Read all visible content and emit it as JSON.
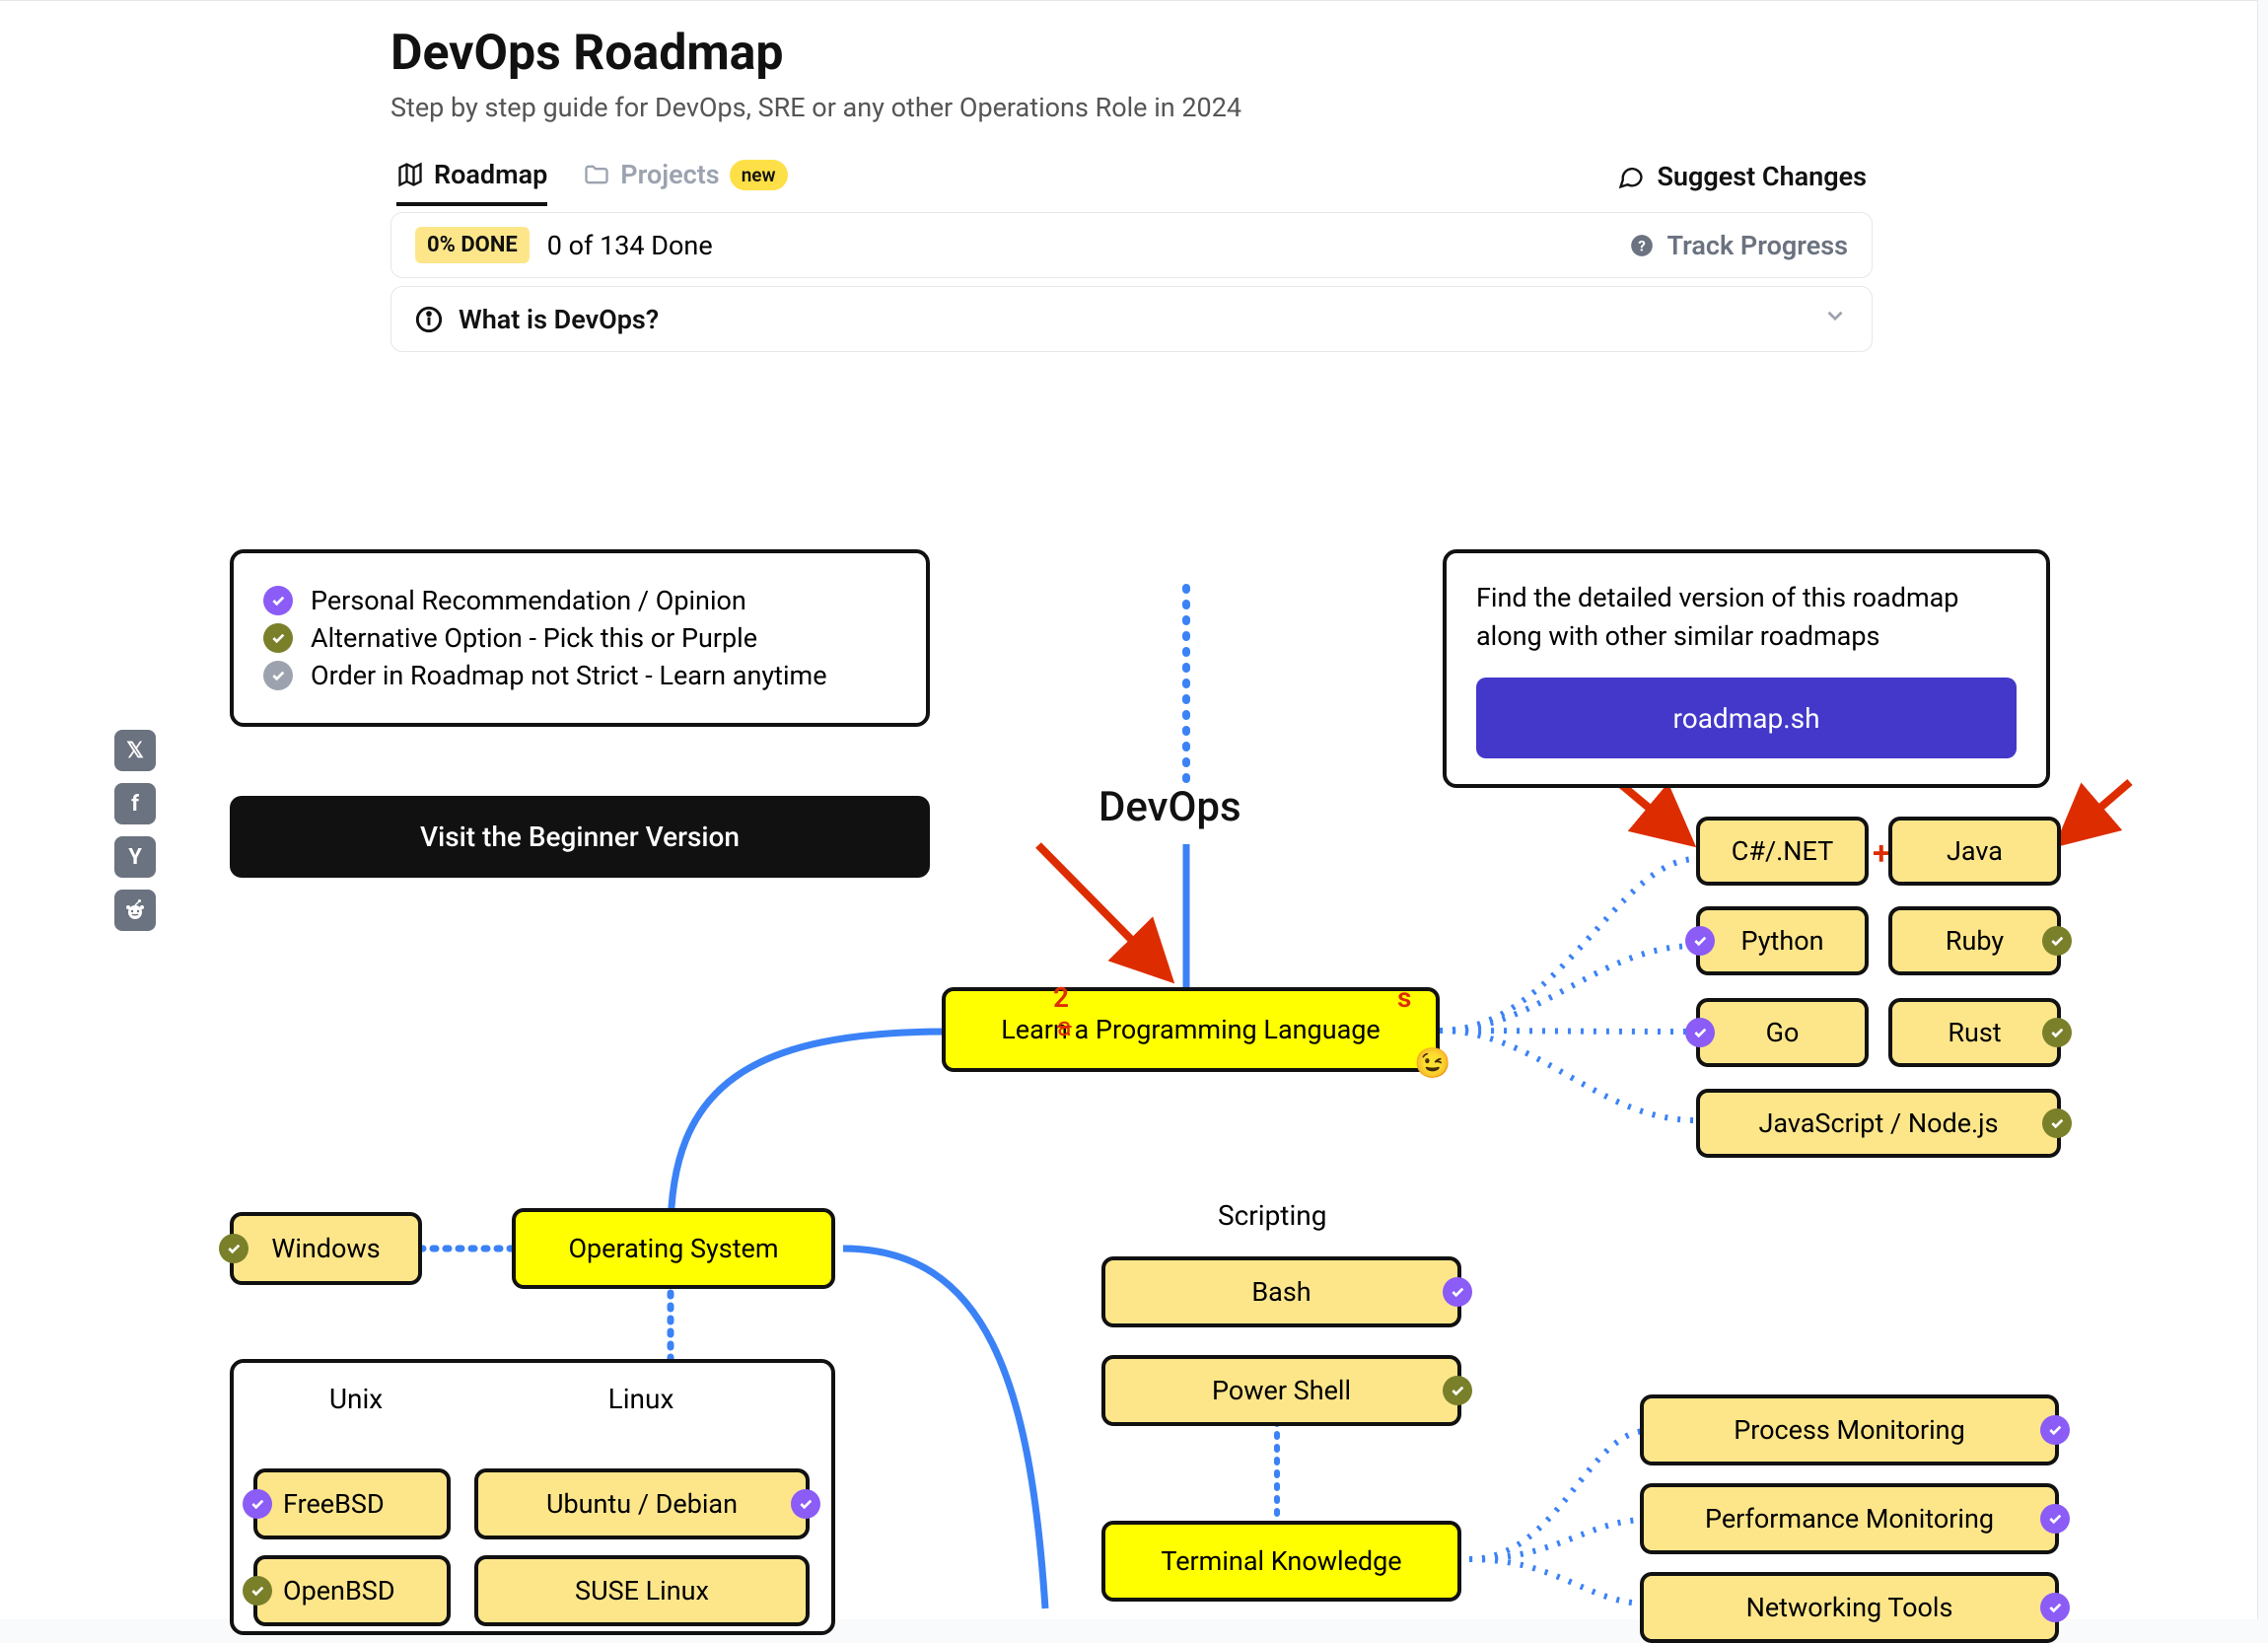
{
  "header": {
    "title": "DevOps Roadmap",
    "subtitle": "Step by step guide for DevOps, SRE or any other Operations Role in 2024"
  },
  "tabs": {
    "roadmap": "Roadmap",
    "projects": "Projects",
    "new_pill": "new",
    "suggest": "Suggest Changes"
  },
  "progress": {
    "done_chip": "0% DONE",
    "count": "0 of 134 Done",
    "track": "Track Progress"
  },
  "question": "What is DevOps?",
  "legend": {
    "personal": "Personal Recommendation / Opinion",
    "alternative": "Alternative Option - Pick this or Purple",
    "order": "Order in Roadmap not Strict - Learn anytime"
  },
  "beginner_btn": "Visit the Beginner Version",
  "promo": {
    "text": "Find the detailed version of this roadmap along with other similar roadmaps",
    "button": "roadmap.sh"
  },
  "headings": {
    "devops": "DevOps",
    "scripting": "Scripting",
    "unix": "Unix",
    "linux": "Linux"
  },
  "nodes": {
    "learn_lang": "Learn a Programming Language",
    "csharp": "C#/.NET",
    "java": "Java",
    "python": "Python",
    "ruby": "Ruby",
    "go": "Go",
    "rust": "Rust",
    "js": "JavaScript / Node.js",
    "os": "Operating System",
    "windows": "Windows",
    "freebsd": "FreeBSD",
    "openbsd": "OpenBSD",
    "ubuntu": "Ubuntu / Debian",
    "suse": "SUSE Linux",
    "bash": "Bash",
    "powershell": "Power Shell",
    "terminal": "Terminal Knowledge",
    "proc_mon": "Process Monitoring",
    "perf_mon": "Performance Monitoring",
    "net_tools": "Networking Tools"
  },
  "annotations": {
    "two": "2",
    "s": "s",
    "plus": "+"
  },
  "share": {
    "x": "𝕏",
    "fb": "f",
    "yc": "Y",
    "reddit": "👽"
  }
}
